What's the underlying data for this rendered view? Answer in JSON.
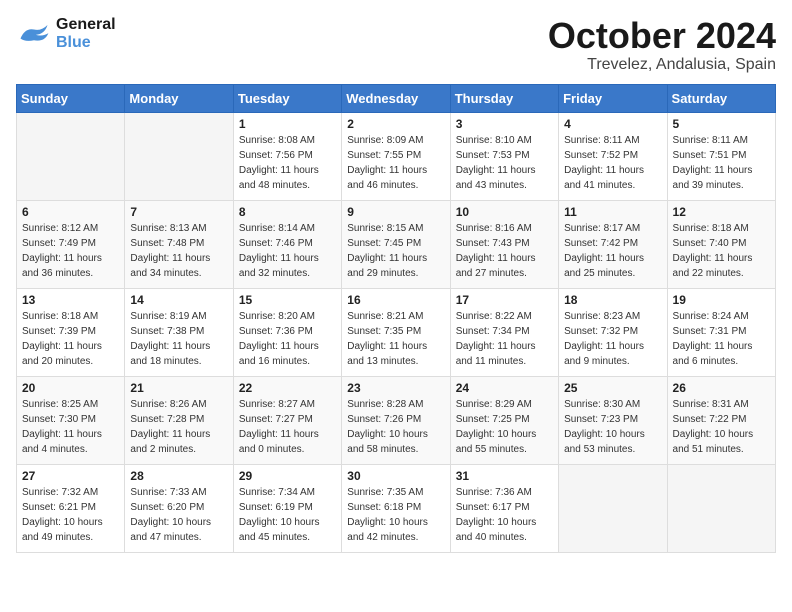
{
  "header": {
    "logo_line1": "General",
    "logo_line2": "Blue",
    "month": "October 2024",
    "location": "Trevelez, Andalusia, Spain"
  },
  "weekdays": [
    "Sunday",
    "Monday",
    "Tuesday",
    "Wednesday",
    "Thursday",
    "Friday",
    "Saturday"
  ],
  "weeks": [
    [
      {
        "day": "",
        "info": ""
      },
      {
        "day": "",
        "info": ""
      },
      {
        "day": "1",
        "info": "Sunrise: 8:08 AM\nSunset: 7:56 PM\nDaylight: 11 hours and 48 minutes."
      },
      {
        "day": "2",
        "info": "Sunrise: 8:09 AM\nSunset: 7:55 PM\nDaylight: 11 hours and 46 minutes."
      },
      {
        "day": "3",
        "info": "Sunrise: 8:10 AM\nSunset: 7:53 PM\nDaylight: 11 hours and 43 minutes."
      },
      {
        "day": "4",
        "info": "Sunrise: 8:11 AM\nSunset: 7:52 PM\nDaylight: 11 hours and 41 minutes."
      },
      {
        "day": "5",
        "info": "Sunrise: 8:11 AM\nSunset: 7:51 PM\nDaylight: 11 hours and 39 minutes."
      }
    ],
    [
      {
        "day": "6",
        "info": "Sunrise: 8:12 AM\nSunset: 7:49 PM\nDaylight: 11 hours and 36 minutes."
      },
      {
        "day": "7",
        "info": "Sunrise: 8:13 AM\nSunset: 7:48 PM\nDaylight: 11 hours and 34 minutes."
      },
      {
        "day": "8",
        "info": "Sunrise: 8:14 AM\nSunset: 7:46 PM\nDaylight: 11 hours and 32 minutes."
      },
      {
        "day": "9",
        "info": "Sunrise: 8:15 AM\nSunset: 7:45 PM\nDaylight: 11 hours and 29 minutes."
      },
      {
        "day": "10",
        "info": "Sunrise: 8:16 AM\nSunset: 7:43 PM\nDaylight: 11 hours and 27 minutes."
      },
      {
        "day": "11",
        "info": "Sunrise: 8:17 AM\nSunset: 7:42 PM\nDaylight: 11 hours and 25 minutes."
      },
      {
        "day": "12",
        "info": "Sunrise: 8:18 AM\nSunset: 7:40 PM\nDaylight: 11 hours and 22 minutes."
      }
    ],
    [
      {
        "day": "13",
        "info": "Sunrise: 8:18 AM\nSunset: 7:39 PM\nDaylight: 11 hours and 20 minutes."
      },
      {
        "day": "14",
        "info": "Sunrise: 8:19 AM\nSunset: 7:38 PM\nDaylight: 11 hours and 18 minutes."
      },
      {
        "day": "15",
        "info": "Sunrise: 8:20 AM\nSunset: 7:36 PM\nDaylight: 11 hours and 16 minutes."
      },
      {
        "day": "16",
        "info": "Sunrise: 8:21 AM\nSunset: 7:35 PM\nDaylight: 11 hours and 13 minutes."
      },
      {
        "day": "17",
        "info": "Sunrise: 8:22 AM\nSunset: 7:34 PM\nDaylight: 11 hours and 11 minutes."
      },
      {
        "day": "18",
        "info": "Sunrise: 8:23 AM\nSunset: 7:32 PM\nDaylight: 11 hours and 9 minutes."
      },
      {
        "day": "19",
        "info": "Sunrise: 8:24 AM\nSunset: 7:31 PM\nDaylight: 11 hours and 6 minutes."
      }
    ],
    [
      {
        "day": "20",
        "info": "Sunrise: 8:25 AM\nSunset: 7:30 PM\nDaylight: 11 hours and 4 minutes."
      },
      {
        "day": "21",
        "info": "Sunrise: 8:26 AM\nSunset: 7:28 PM\nDaylight: 11 hours and 2 minutes."
      },
      {
        "day": "22",
        "info": "Sunrise: 8:27 AM\nSunset: 7:27 PM\nDaylight: 11 hours and 0 minutes."
      },
      {
        "day": "23",
        "info": "Sunrise: 8:28 AM\nSunset: 7:26 PM\nDaylight: 10 hours and 58 minutes."
      },
      {
        "day": "24",
        "info": "Sunrise: 8:29 AM\nSunset: 7:25 PM\nDaylight: 10 hours and 55 minutes."
      },
      {
        "day": "25",
        "info": "Sunrise: 8:30 AM\nSunset: 7:23 PM\nDaylight: 10 hours and 53 minutes."
      },
      {
        "day": "26",
        "info": "Sunrise: 8:31 AM\nSunset: 7:22 PM\nDaylight: 10 hours and 51 minutes."
      }
    ],
    [
      {
        "day": "27",
        "info": "Sunrise: 7:32 AM\nSunset: 6:21 PM\nDaylight: 10 hours and 49 minutes."
      },
      {
        "day": "28",
        "info": "Sunrise: 7:33 AM\nSunset: 6:20 PM\nDaylight: 10 hours and 47 minutes."
      },
      {
        "day": "29",
        "info": "Sunrise: 7:34 AM\nSunset: 6:19 PM\nDaylight: 10 hours and 45 minutes."
      },
      {
        "day": "30",
        "info": "Sunrise: 7:35 AM\nSunset: 6:18 PM\nDaylight: 10 hours and 42 minutes."
      },
      {
        "day": "31",
        "info": "Sunrise: 7:36 AM\nSunset: 6:17 PM\nDaylight: 10 hours and 40 minutes."
      },
      {
        "day": "",
        "info": ""
      },
      {
        "day": "",
        "info": ""
      }
    ]
  ]
}
